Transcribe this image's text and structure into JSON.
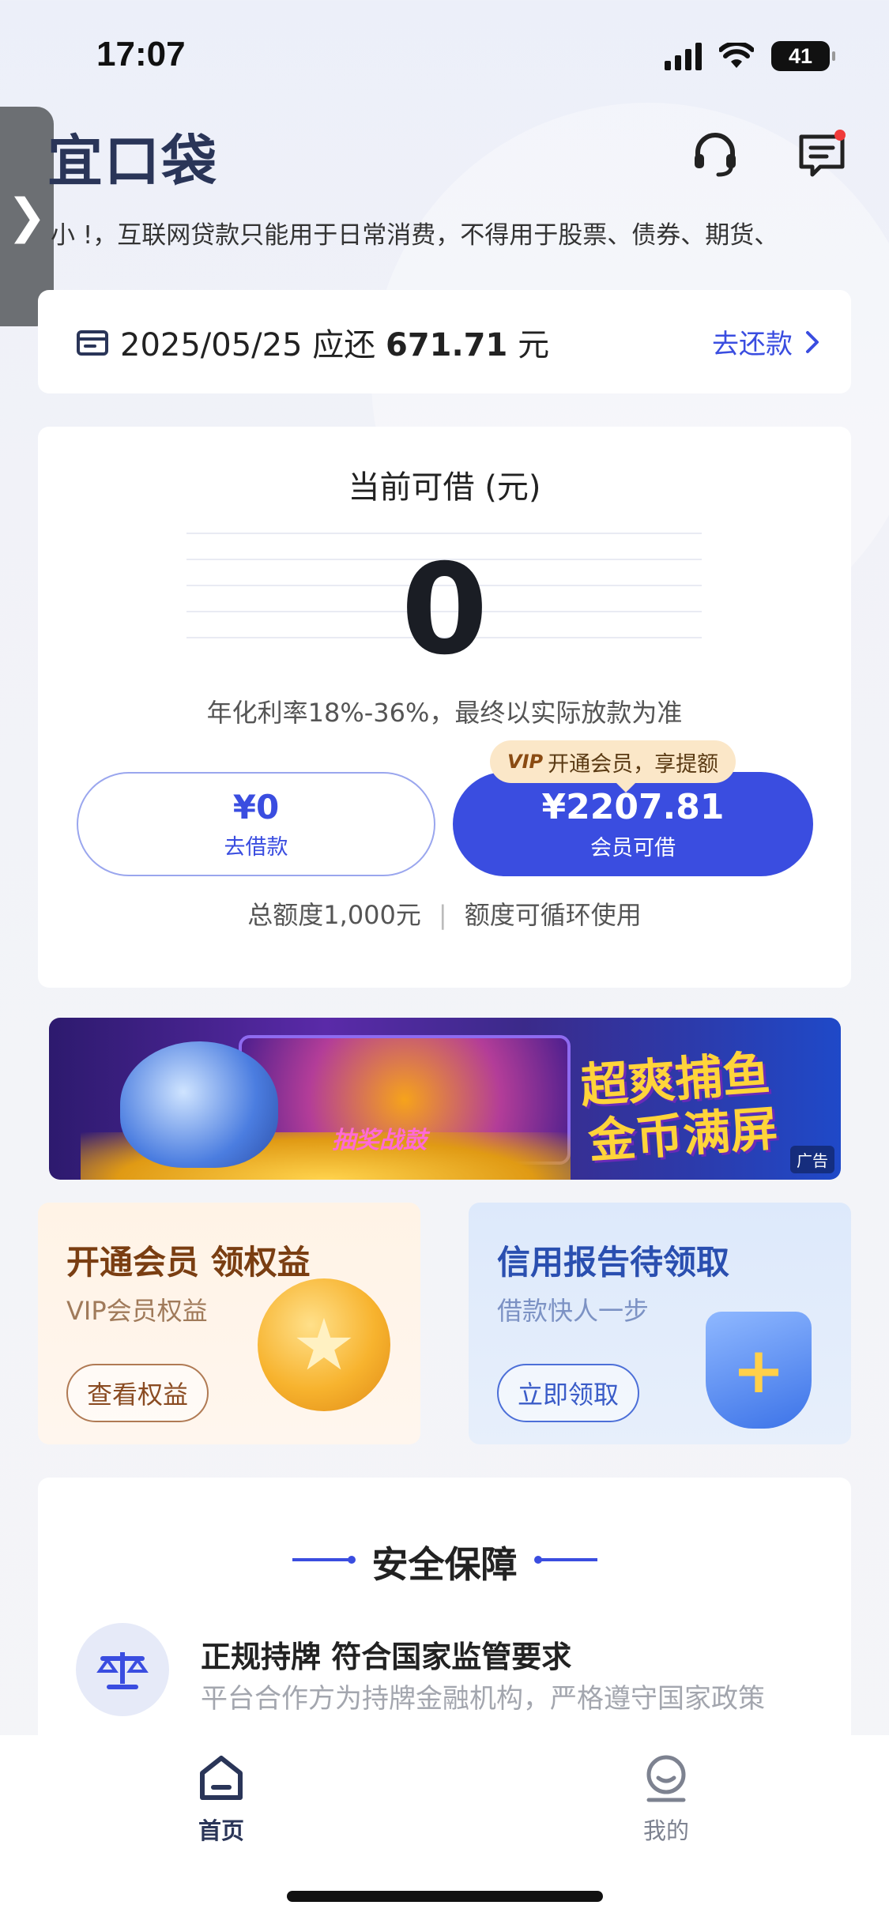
{
  "status_bar": {
    "time": "17:07",
    "battery": "41"
  },
  "header": {
    "app_name": "宜口袋",
    "side_tab_icon": "chevron-right-icon",
    "notice": "小 !，互联网贷款只能用于日常消费，不得用于股票、债券、期货、"
  },
  "repay": {
    "date": "2025/05/25",
    "prefix": "应还",
    "amount": "671.71",
    "unit": "元",
    "action": "去还款"
  },
  "credit": {
    "title": "当前可借 (元)",
    "value": "0",
    "rate_note": "年化利率18%-36%，最终以实际放款为准",
    "borrow_button": {
      "amount": "¥0",
      "label": "去借款"
    },
    "vip_tip": {
      "tag": "VIP",
      "text": "开通会员，享提额"
    },
    "vip_button": {
      "amount": "¥2207.81",
      "label": "会员可借"
    },
    "total_quota": "总额度1,000元",
    "quota_note": "额度可循环使用"
  },
  "banner": {
    "badge": "抽奖战鼓",
    "slogan_line1": "超爽捕鱼",
    "slogan_line2": "金币满屏",
    "ad_tag": "广告"
  },
  "promo_cards": [
    {
      "title": "开通会员 领权益",
      "subtitle": "VIP会员权益",
      "button": "查看权益"
    },
    {
      "title": "信用报告待领取",
      "subtitle": "借款快人一步",
      "button": "立即领取"
    }
  ],
  "safety": {
    "title": "安全保障",
    "item_title": "正规持牌 符合国家监管要求",
    "item_desc": "平台合作方为持牌金融机构，严格遵守国家政策"
  },
  "bottom_nav": [
    {
      "label": "首页",
      "icon": "home-icon"
    },
    {
      "label": "我的",
      "icon": "user-icon"
    }
  ],
  "colors": {
    "primary": "#3a4de0",
    "title": "#2a3558",
    "vip_tip_bg": "#fbe7c8"
  }
}
